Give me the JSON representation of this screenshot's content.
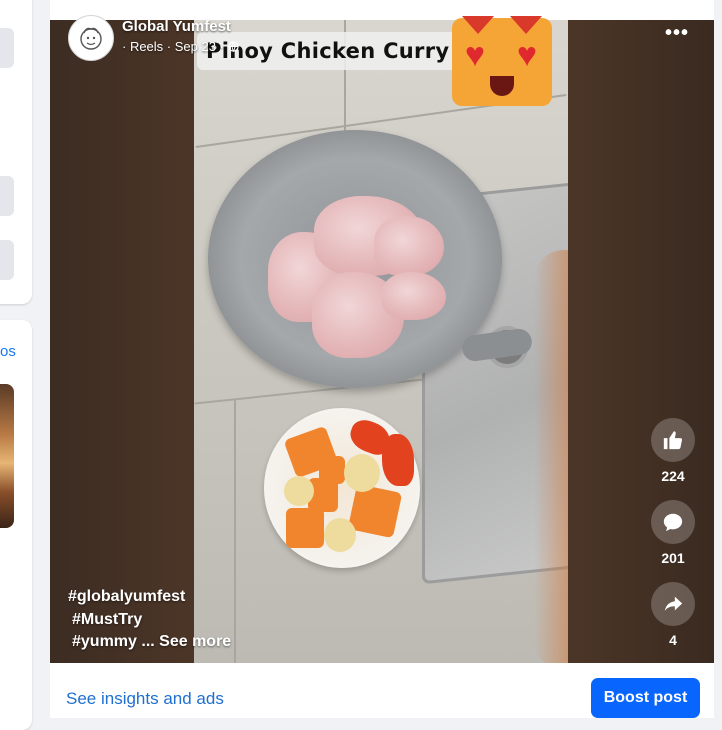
{
  "post": {
    "author": "Global Yumfest",
    "meta": "· Reels · Sep 23 ·",
    "menu_icon": "more-horizontal-icon",
    "privacy_icon": "globe-icon"
  },
  "video": {
    "title_overlay": "Pinoy Chicken Curry",
    "sticker": "heart-eyes-cat-sticker"
  },
  "caption": {
    "line1": "#globalyumfest",
    "line2": "#MustTry",
    "line3": "#yummy",
    "see_more": "... See more"
  },
  "actions": {
    "like": {
      "icon": "thumbs-up-icon",
      "count": "224"
    },
    "comment": {
      "icon": "comment-icon",
      "count": "201"
    },
    "share": {
      "icon": "share-icon",
      "count": "4"
    }
  },
  "footer": {
    "insights_link": "See insights and ads",
    "boost_button": "Boost post"
  },
  "left_panel": {
    "link_fragment": "os"
  },
  "colors": {
    "brand_blue": "#0866ff",
    "link_blue": "#1f6fd1",
    "page_bg": "#f0f2f5"
  }
}
